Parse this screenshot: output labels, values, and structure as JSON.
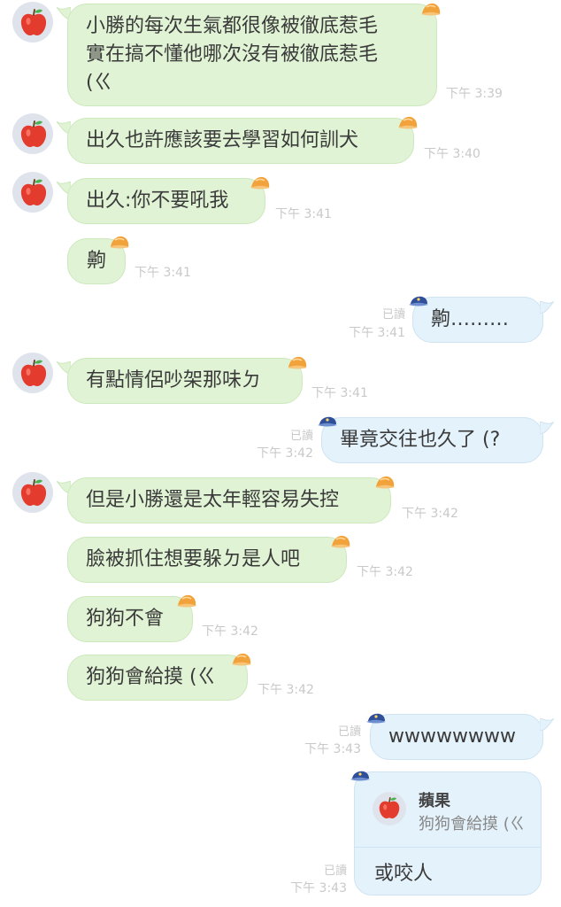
{
  "colors": {
    "incoming_bubble": "#e1f3d5",
    "outgoing_bubble": "#e4f2fb",
    "timestamp": "#c9c9c9",
    "avatar_bg": "#dfe3ec"
  },
  "icons": {
    "avatar": "apple-icon",
    "incoming_decoration": "orange-hat-icon",
    "outgoing_decoration": "blue-cap-icon"
  },
  "messages": [
    {
      "side": "in",
      "text": "小勝的每次生氣都很像被徹底惹毛\n實在搞不懂他哪次沒有被徹底惹毛\n(ㄍ",
      "time": "下午 3:39"
    },
    {
      "side": "in",
      "text": "出久也許應該要去學習如何訓犬",
      "time": "下午 3:40"
    },
    {
      "side": "in",
      "text": "出久:你不要吼我",
      "time": "下午 3:41"
    },
    {
      "side": "in",
      "text": "齁",
      "time": "下午 3:41"
    },
    {
      "side": "out",
      "text": "齁………",
      "time": "下午 3:41",
      "read": "已讀"
    },
    {
      "side": "in",
      "text": "有點情侶吵架那味ㄉ",
      "time": "下午 3:41"
    },
    {
      "side": "out",
      "text": "畢竟交往也久了 (?",
      "time": "下午 3:42",
      "read": "已讀"
    },
    {
      "side": "in",
      "text": "但是小勝還是太年輕容易失控",
      "time": "下午 3:42"
    },
    {
      "side": "in",
      "text": "臉被抓住想要躲ㄉ是人吧",
      "time": "下午 3:42"
    },
    {
      "side": "in",
      "text": "狗狗不會",
      "time": "下午 3:42"
    },
    {
      "side": "in",
      "text": "狗狗會給摸 (ㄍ",
      "time": "下午 3:42"
    },
    {
      "side": "out",
      "text": "wwwwwwww",
      "time": "下午 3:43",
      "read": "已讀"
    }
  ],
  "reply_message": {
    "quoted_name": "蘋果",
    "quoted_text": "狗狗會給摸 (ㄍ",
    "text": "或咬人",
    "time": "下午 3:43",
    "read": "已讀"
  }
}
